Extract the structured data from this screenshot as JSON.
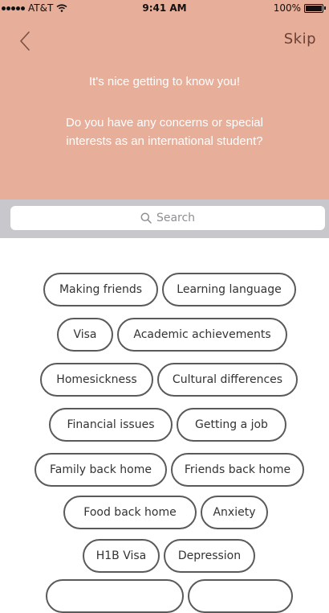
{
  "status_bar": {
    "carrier": "AT&T",
    "time": "9:41 AM",
    "battery": "100%"
  },
  "nav": {
    "skip_label": "Skip"
  },
  "header": {
    "greeting": "It's nice getting to know you!",
    "question": "Do you have any concerns or special interests as an international student?"
  },
  "search": {
    "placeholder": "Search"
  },
  "topics": [
    "Making friends",
    "Learning language",
    "Visa",
    "Academic achievements",
    "Homesickness",
    "Cultural differences",
    "Financial issues",
    "Getting a job",
    "Family back home",
    "Friends back home",
    "Food back home",
    "Anxiety",
    "H1B Visa",
    "Depression"
  ],
  "colors": {
    "header_bg": "#e7ae9a",
    "chip_border": "#5a5a5a",
    "search_band": "#c8c8cc"
  }
}
